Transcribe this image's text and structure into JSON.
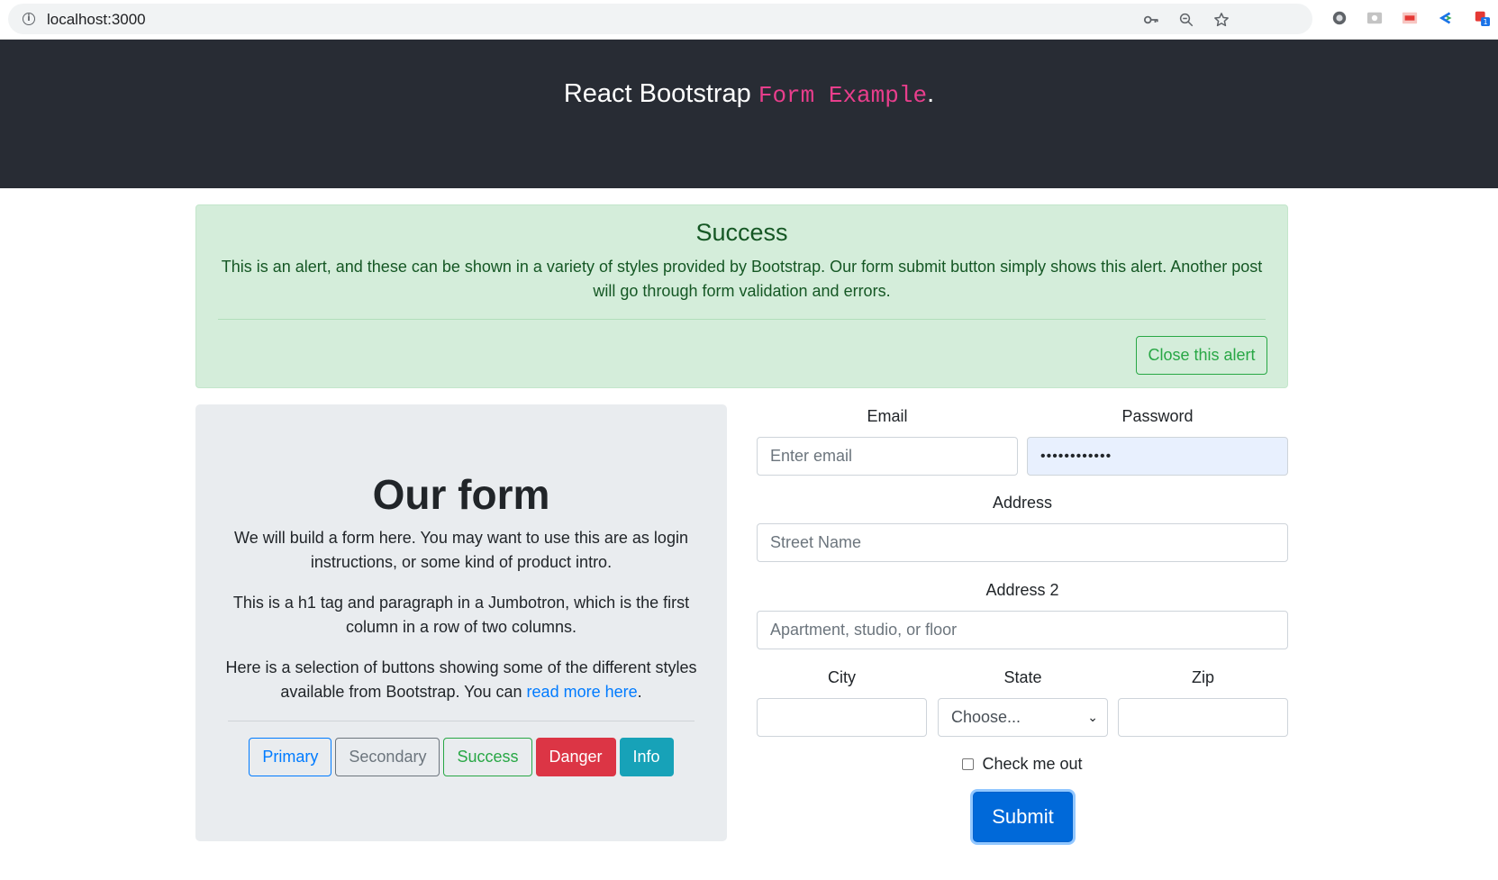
{
  "browser": {
    "url": "localhost:3000",
    "icons": [
      "info-icon",
      "key-icon",
      "zoom-out-icon",
      "star-icon"
    ],
    "extensions": [
      "extension-circle-icon",
      "extension-camera-icon",
      "extension-pdf-icon",
      "extension-c-icon",
      "extension-puzzle-icon"
    ],
    "ext_badge": "1"
  },
  "header": {
    "title_plain": "React Bootstrap ",
    "title_code": "Form Example",
    "title_end": ".",
    "code_color": "#e83e8c",
    "bg_color": "#282c34"
  },
  "alert": {
    "heading": "Success",
    "body": "This is an alert, and these can be shown in a variety of styles provided by Bootstrap. Our form submit button simply shows this alert. Another post will go through form validation and errors.",
    "close_label": "Close this alert",
    "bg_color": "#d4edda",
    "text_color": "#155724"
  },
  "jumbotron": {
    "title": "Our form",
    "p1": "We will build a form here. You may want to use this are as login instructions, or some kind of product intro.",
    "p2": "This is a h1 tag and paragraph in a Jumbotron, which is the first column in a row of two columns.",
    "p3_before": "Here is a selection of buttons showing some of the different styles available from Bootstrap. You can ",
    "p3_link": "read more here",
    "p3_after": ".",
    "buttons": {
      "primary": "Primary",
      "secondary": "Secondary",
      "success": "Success",
      "danger": "Danger",
      "info": "Info"
    }
  },
  "form": {
    "email_label": "Email",
    "email_placeholder": "Enter email",
    "password_label": "Password",
    "password_value": "••••••••••••",
    "address_label": "Address",
    "address_placeholder": "Street Name",
    "address2_label": "Address 2",
    "address2_placeholder": "Apartment, studio, or floor",
    "city_label": "City",
    "state_label": "State",
    "state_selected": "Choose...",
    "zip_label": "Zip",
    "check_label": "Check me out",
    "submit_label": "Submit"
  }
}
